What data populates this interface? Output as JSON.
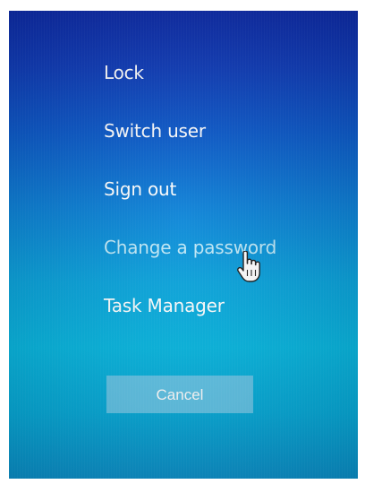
{
  "menu": {
    "items": [
      {
        "label": "Lock"
      },
      {
        "label": "Switch user"
      },
      {
        "label": "Sign out"
      },
      {
        "label": "Change a password"
      },
      {
        "label": "Task Manager"
      }
    ]
  },
  "cancel_label": "Cancel",
  "colors": {
    "background_top": "#0c2aa8",
    "background_bottom": "#06b6e0",
    "text": "#ffffff",
    "hover_text": "#bfe8f7",
    "button": "#5fc3e6"
  },
  "icons": {
    "cursor": "hand-pointer-icon"
  }
}
